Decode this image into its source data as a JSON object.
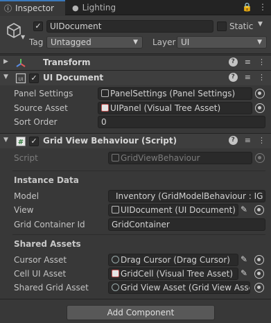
{
  "tabs": [
    {
      "label": "Inspector",
      "icon": "info-icon",
      "active": true
    },
    {
      "label": "Lighting",
      "icon": "bulb-icon",
      "active": false
    }
  ],
  "game_object": {
    "active": true,
    "name": "UIDocument",
    "static_label": "Static",
    "tag_label": "Tag",
    "tag_value": "Untagged",
    "layer_label": "Layer",
    "layer_value": "UI"
  },
  "components": {
    "transform": {
      "title": "Transform"
    },
    "ui_document": {
      "title": "UI Document",
      "enabled": true,
      "panel_settings_label": "Panel Settings",
      "panel_settings_value": "PanelSettings (Panel Settings)",
      "source_asset_label": "Source Asset",
      "source_asset_value": "UIPanel (Visual Tree Asset)",
      "sort_order_label": "Sort Order",
      "sort_order_value": "0"
    },
    "grid_view": {
      "title": "Grid View Behaviour (Script)",
      "enabled": true,
      "script_label": "Script",
      "script_value": "GridViewBehaviour",
      "instance_data_heading": "Instance Data",
      "model_label": "Model",
      "model_value": "Inventory (GridModelBehaviour : IG",
      "view_label": "View",
      "view_value": "UIDocument (UI Document)",
      "grid_container_label": "Grid Container Id",
      "grid_container_value": "GridContainer",
      "shared_assets_heading": "Shared Assets",
      "cursor_label": "Cursor Asset",
      "cursor_value": "Drag Cursor (Drag Cursor)",
      "cell_label": "Cell UI Asset",
      "cell_value": "GridCell (Visual Tree Asset)",
      "shared_grid_label": "Shared Grid Asset",
      "shared_grid_value": "Grid View Asset (Grid View Asset)"
    }
  },
  "add_component_label": "Add Component",
  "colors": {
    "background": "#383838",
    "accent": "#3a79bb",
    "field": "#2a2a2a",
    "header": "#3e3e3e"
  }
}
